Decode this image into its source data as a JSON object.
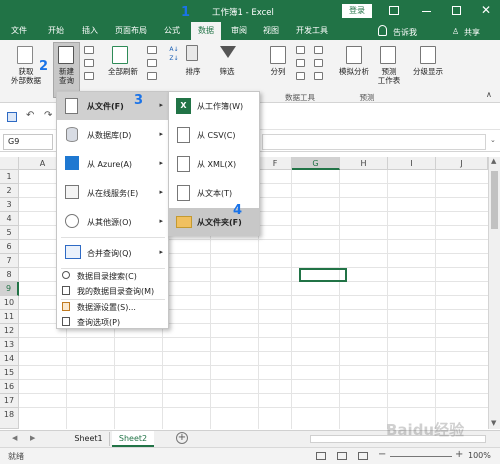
{
  "window": {
    "title": "工作簿1  -  Excel",
    "login_label": "登录"
  },
  "tabs": [
    "文件",
    "开始",
    "插入",
    "页面布局",
    "公式",
    "数据",
    "审阅",
    "视图",
    "开发工具"
  ],
  "tell_me": "告诉我",
  "share": "共享",
  "ribbon": {
    "get_external": "获取\n外部数据",
    "new_query": "新建\n查询",
    "refresh_all": "全部刷新",
    "sort": "排序",
    "filter": "筛选",
    "split": "分列",
    "whatif": "模拟分析",
    "forecast": "预测\n工作表",
    "outline": "分级显示",
    "group_data_tools": "数据工具",
    "group_forecast": "预测"
  },
  "name_box": "G9",
  "columns": [
    "A",
    "B",
    "C",
    "D",
    "E",
    "F",
    "G",
    "H",
    "I",
    "J"
  ],
  "rows": [
    "1",
    "2",
    "3",
    "4",
    "5",
    "6",
    "7",
    "8",
    "9",
    "10",
    "11",
    "12",
    "13",
    "14",
    "15",
    "16",
    "17",
    "18"
  ],
  "sheets": [
    "Sheet1",
    "Sheet2"
  ],
  "status": {
    "ready": "就绪",
    "zoom": "100%"
  },
  "menu1": {
    "from_file": "从文件(F)",
    "from_db": "从数据库(D)",
    "from_azure": "从 Azure(A)",
    "from_online": "从在线服务(E)",
    "from_other": "从其他源(O)",
    "combine": "合并查询(Q)",
    "catalog_search": "数据目录搜索(C)",
    "my_catalog": "我的数据目录查询(M)",
    "ds_settings": "数据源设置(S)...",
    "query_options": "查询选项(P)"
  },
  "menu2": {
    "workbook": "从工作簿(W)",
    "csv": "从 CSV(C)",
    "xml": "从 XML(X)",
    "text": "从文本(T)",
    "folder": "从文件夹(F)"
  },
  "badges": [
    "1",
    "2",
    "3",
    "4"
  ],
  "watermark": "Baidu经验",
  "colors": {
    "excel_green": "#217346",
    "badge_blue": "#1a73e8",
    "select_gray": "#d0d0d0",
    "hover_gray": "#c8c8c8"
  }
}
